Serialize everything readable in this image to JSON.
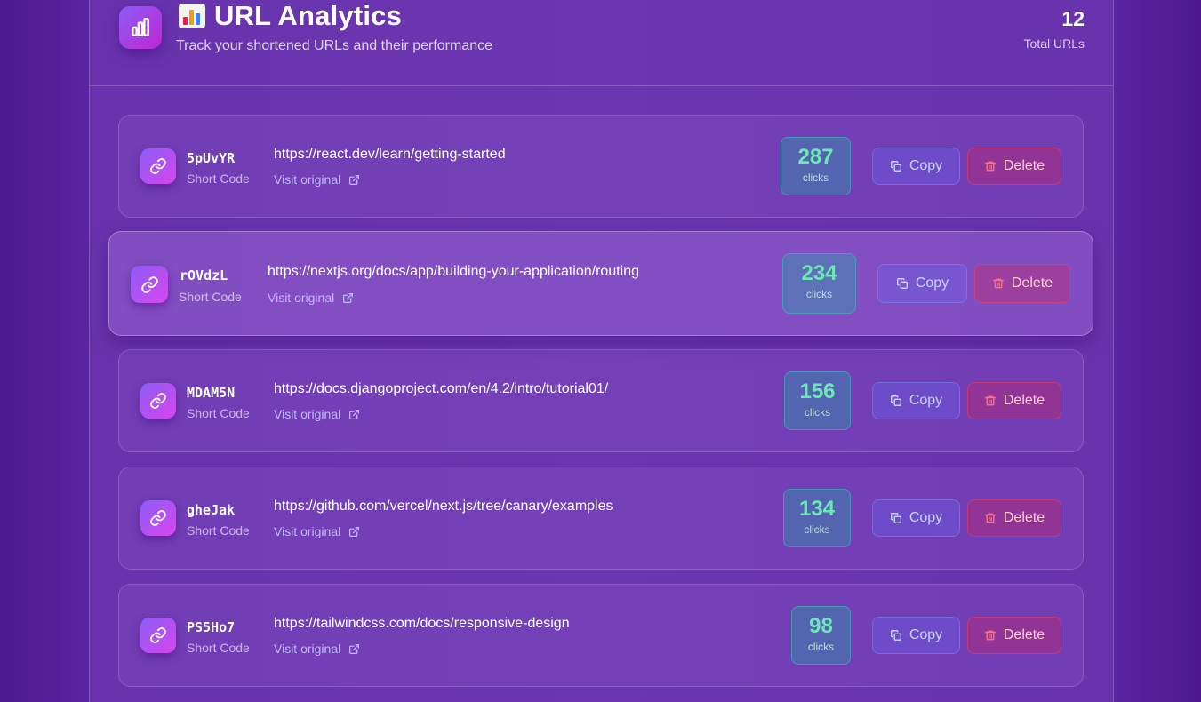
{
  "header": {
    "title": "URL Analytics",
    "title_emoji_icon": "bar-chart-emoji",
    "subtitle": "Track your shortened URLs and their performance",
    "total_count": "12",
    "total_label": "Total URLs"
  },
  "labels": {
    "short_code": "Short Code",
    "visit_original": "Visit original",
    "clicks": "clicks",
    "copy": "Copy",
    "delete": "Delete"
  },
  "urls": [
    {
      "code": "5pUvYR",
      "url": "https://react.dev/learn/getting-started",
      "clicks": "287"
    },
    {
      "code": "rOVdzL",
      "url": "https://nextjs.org/docs/app/building-your-application/routing",
      "clicks": "234"
    },
    {
      "code": "MDAM5N",
      "url": "https://docs.djangoproject.com/en/4.2/intro/tutorial01/",
      "clicks": "156"
    },
    {
      "code": "gheJak",
      "url": "https://github.com/vercel/next.js/tree/canary/examples",
      "clicks": "134"
    },
    {
      "code": "PS5Ho7",
      "url": "https://tailwindcss.com/docs/responsive-design",
      "clicks": "98"
    }
  ],
  "colors": {
    "accent": "#8b5cf6",
    "clicks_text": "#6ee7b7",
    "delete": "#f43f5e"
  }
}
